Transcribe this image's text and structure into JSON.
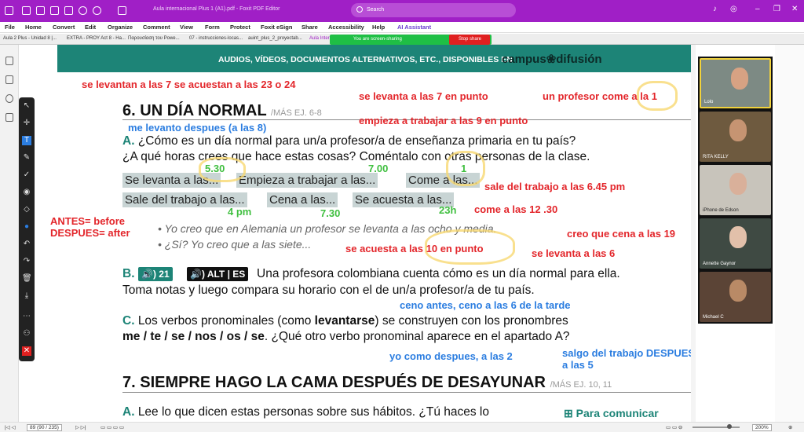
{
  "app": {
    "title": "Aula internacional Plus 1 (A1).pdf - Foxit PDF Editor",
    "search_placeholder": "Search"
  },
  "menu": [
    "File",
    "Home",
    "Convert",
    "Edit",
    "Organize",
    "Comment",
    "View",
    "Form",
    "Protect",
    "Foxit eSign",
    "Share",
    "Accessibility",
    "Help",
    "AI Assistant"
  ],
  "tabs": [
    "Aula 2 Plus - Unidad 8 |...",
    "EXTRA - PROY Act 8 - Ha...",
    "Παρουσίαση του Powe...",
    "07 - instrucciones-locas...",
    "auint_plus_2_proyectab...",
    "Aula Inter"
  ],
  "share": {
    "message": "You are screen-sharing",
    "stop": "Stop share"
  },
  "page": {
    "banner_text": "AUDIOS, VÍDEOS, DOCUMENTOS ALTERNATIVOS, ETC., DISPONIBLES EN",
    "banner_logo": "campus❀difusión",
    "sec6_num": "6.",
    "sec6_title": "UN DÍA NORMAL",
    "sec6_sub": "/MÁS EJ. 6-8",
    "a_letter": "A.",
    "a_line1": "¿Cómo es un día normal para un/a profesor/a de enseñanza primaria en tu país?",
    "a_line2": "¿A qué horas crees que hace estas cosas? Coméntalo con otras personas de la clase.",
    "boxes": [
      "Se levanta a las...",
      "Empieza a trabajar a las...",
      "Come a las...",
      "Sale del trabajo a las...",
      "Cena a las...",
      "Se acuesta a las..."
    ],
    "ex1": "Yo creo que en Alemania un profesor se levanta a las ocho y media.",
    "ex2": "¿Sí? Yo creo que a las siete...",
    "b_letter": "B.",
    "b_audio": "🔊) 21",
    "b_alt": "🔊) ALT | ES",
    "b_line1": "Una profesora colombiana cuenta cómo es un día normal para ella.",
    "b_line2": "Toma notas y luego compara su horario con el de un/a profesor/a de tu país.",
    "c_letter": "C.",
    "c_line1a": "Los verbos pronominales (como ",
    "c_line1b": "levantarse",
    "c_line1c": ") se construyen con los pronombres",
    "c_line2a": "me / te / se / nos / os / se",
    "c_line2b": ". ¿Qué otro verbo pronominal aparece en el apartado A?",
    "sec7_num": "7.",
    "sec7_title": "SIEMPRE HAGO LA CAMA DESPUÉS DE DESAYUNAR",
    "sec7_sub": "/MÁS EJ. 10, 11",
    "a7_letter": "A.",
    "a7_line": "Lee lo que dicen estas personas sobre sus hábitos. ¿Tú haces lo",
    "para": "Para comunicar"
  },
  "notes_red": [
    "se levantan a las 7 se acuestan a las 23 o 24",
    "se levanta a las 7 en punto",
    "un profesor come a la 1",
    "empieza a trabajar a las 9 en punto",
    "sale del trabajo a las 6.45 pm",
    "come a las 12 .30",
    "ANTES= before",
    "DESPUES= after",
    "creo que cena a las 19",
    "se acuesta a las 10 en punto",
    "se levanta a las 6"
  ],
  "notes_blue": [
    "me levanto despues (a las 8)",
    "ceno antes, ceno a las 6 de la tarde",
    "salgo del trabajo DESPUES",
    "a las 5",
    "yo como despues, a las 2"
  ],
  "notes_green": [
    "5.30",
    "7.00",
    "1",
    "4 pm",
    "7.30",
    "23h"
  ],
  "participants": [
    "Lolo",
    "RITA KELLY",
    "iPhone de Edson",
    "Annette Gaynor",
    "Michael C"
  ],
  "status": {
    "page": "89 (90 / 235)",
    "zoom": "200%"
  }
}
